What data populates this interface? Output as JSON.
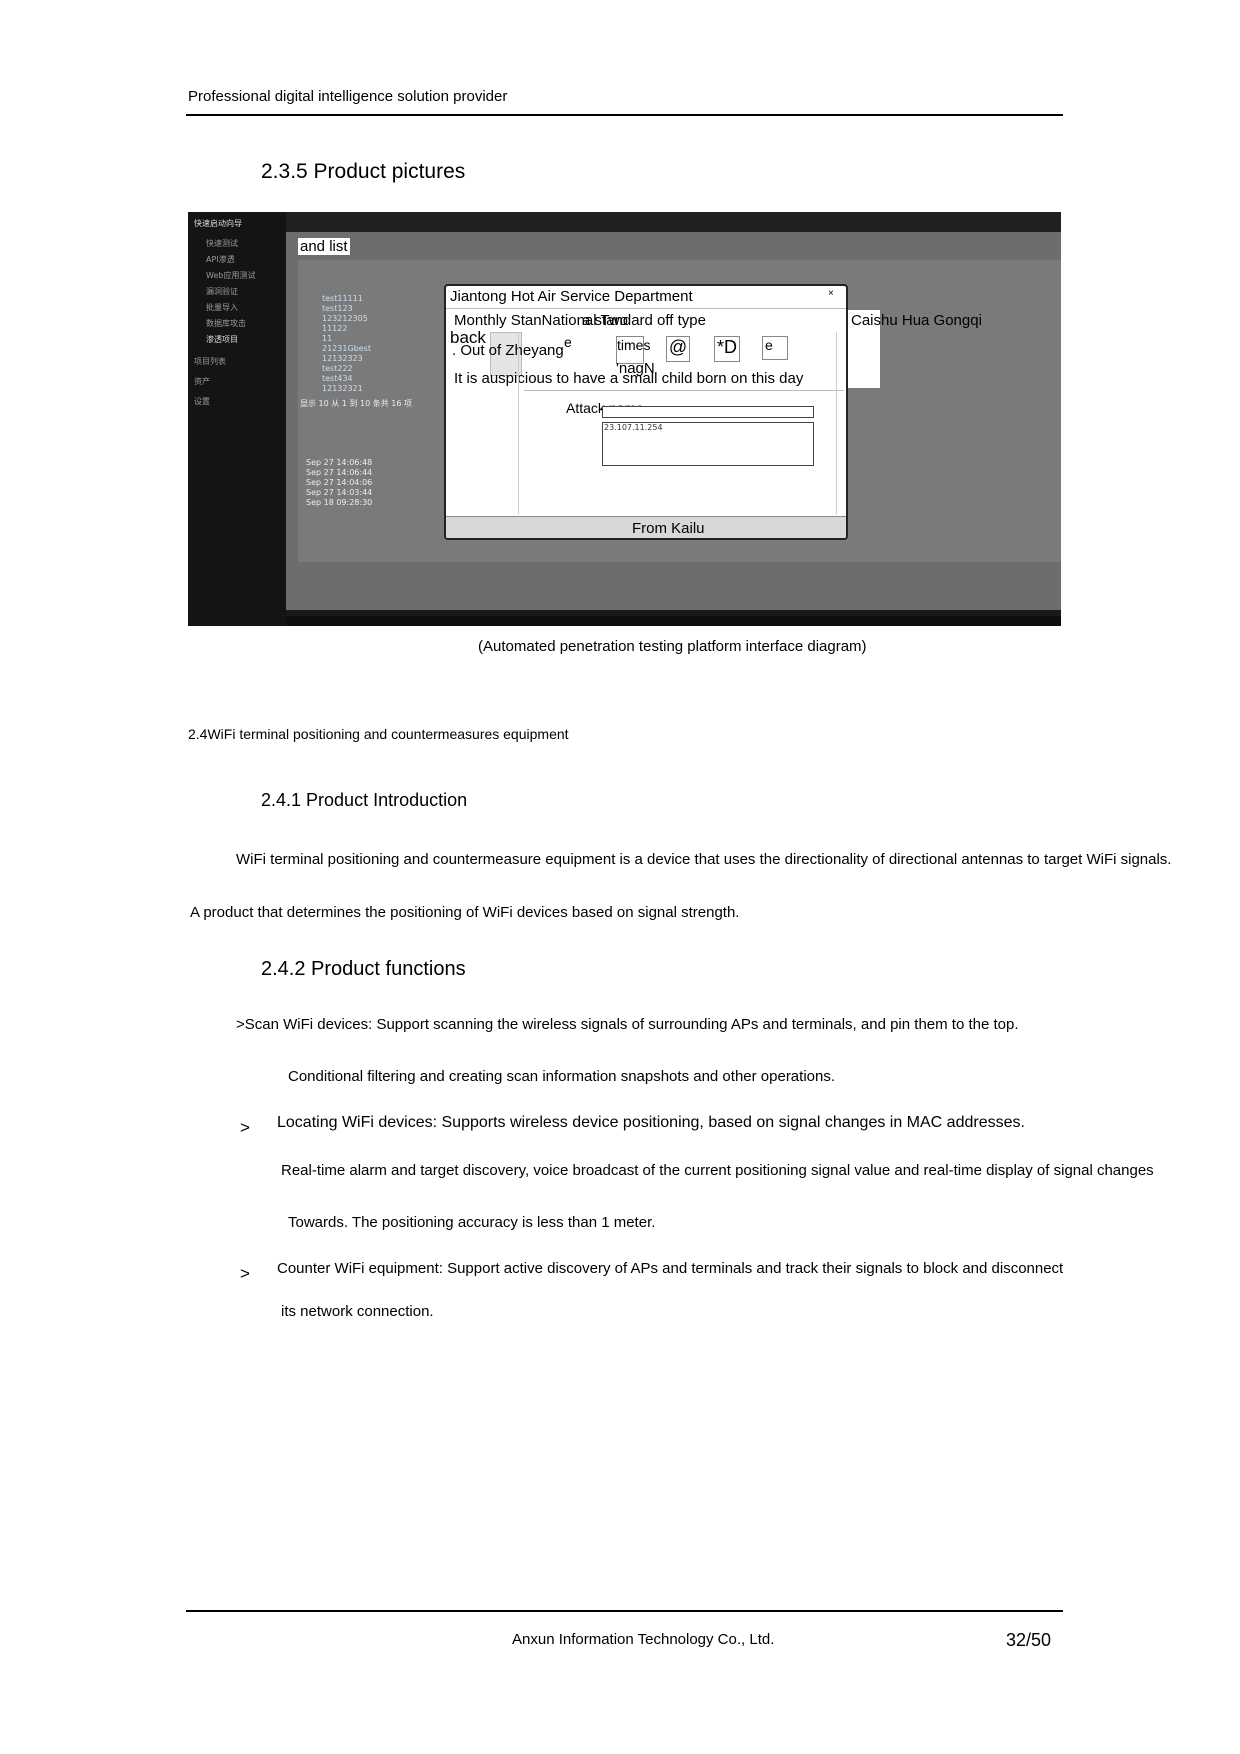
{
  "header": {
    "text": "Professional digital intelligence solution provider"
  },
  "section_235": {
    "heading": "2.3.5 Product pictures"
  },
  "screenshot": {
    "sidebar": {
      "title": "快速启动向导",
      "items": [
        "快速测试",
        "API渗透",
        "Web应用测试",
        "漏洞验证",
        "批量导入",
        "数据库攻击",
        "渗透项目",
        "项目列表",
        "资产",
        "设置"
      ]
    },
    "list_label": "and list",
    "table_names": [
      "test11111",
      "test123",
      "123212305",
      "11122",
      "11",
      "21231Gbest",
      "12132323",
      "test222",
      "test434",
      "12132321"
    ],
    "pager": "显示 10 从 1 到 10 条共 16 项",
    "log_rows": [
      "Sep 27 14:06:48",
      "Sep 27 14:06:44",
      "Sep 27 14:04:06",
      "Sep 27 14:03:44",
      "Sep 18 09:28:30"
    ],
    "modal": {
      "title": "Jiantong Hot Air Service Department",
      "close": "×",
      "line1": "Monthly StanNational Two",
      "line1b": "a standard off type",
      "line2": "back",
      "line3": ". Out of Zheyang",
      "e1": "e",
      "times": "times",
      "at": "@",
      "d": "*D",
      "e2": "e",
      "nagn": "'nagN",
      "line4": "It is auspicious to have a small child born on this day",
      "attack": "Attack name",
      "ip": "23.107.11.254",
      "footer": "From Kailu",
      "right_text": "Caishu Hua Gongqi"
    }
  },
  "caption": "(Automated penetration testing platform interface diagram)",
  "section_24": {
    "heading": "2.4WiFi terminal positioning and countermeasures equipment"
  },
  "section_241": {
    "heading": "2.4.1 Product Introduction",
    "p1": "WiFi terminal positioning and countermeasure equipment is a device that uses the directionality of directional antennas to target WiFi signals.",
    "p2": "A product that determines the positioning of WiFi devices based on signal strength."
  },
  "section_242": {
    "heading": "2.4.2 Product functions",
    "b1a": ">Scan WiFi devices: Support scanning the wireless signals of surrounding APs and terminals, and pin them to the top.",
    "b1b": "Conditional filtering and creating scan information snapshots and other operations.",
    "b2_marker": ">",
    "b2a": "Locating WiFi devices: Supports wireless device positioning, based on signal changes in MAC addresses.",
    "b2b": "Real-time alarm and target discovery, voice broadcast of the current positioning signal value and real-time display of signal changes",
    "b2c": "Towards. The positioning accuracy is less than 1 meter.",
    "b3_marker": ">",
    "b3a": "Counter WiFi equipment: Support active discovery of APs and terminals and track their signals to block and disconnect",
    "b3b": "its network connection."
  },
  "footer": {
    "company": "Anxun Information Technology Co., Ltd.",
    "page": "32/50"
  }
}
